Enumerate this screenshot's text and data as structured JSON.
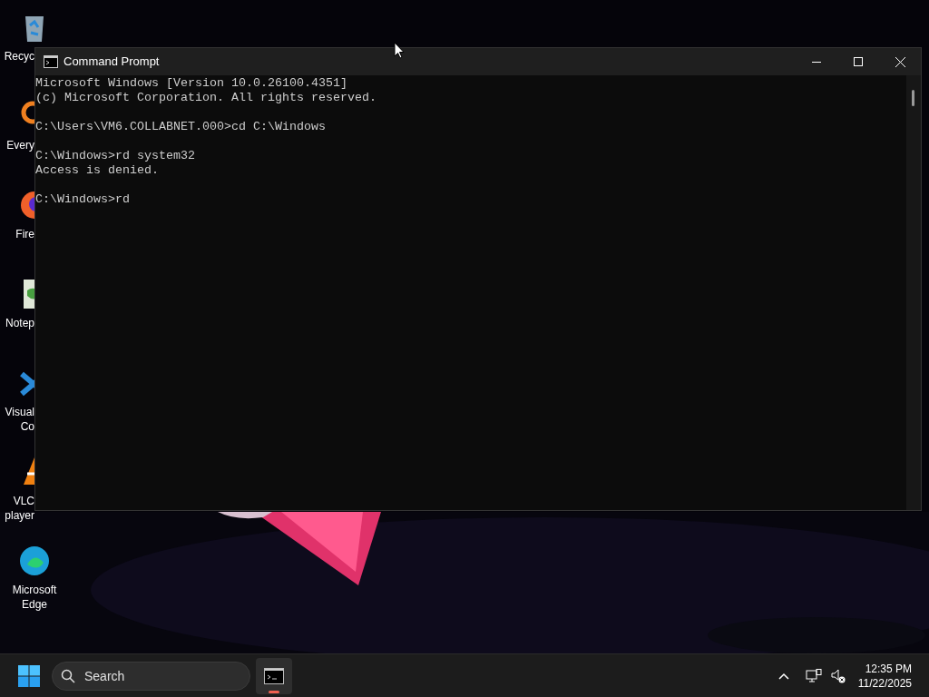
{
  "desktop_icons": [
    {
      "kind": "recycle",
      "lines": [
        "Recyc"
      ]
    },
    {
      "kind": "search",
      "lines": [
        "Every"
      ]
    },
    {
      "kind": "firefox",
      "lines": [
        "Fire"
      ]
    },
    {
      "kind": "notepad",
      "lines": [
        "Notep"
      ]
    },
    {
      "kind": "vscode",
      "lines": [
        "Visual",
        "Co"
      ]
    },
    {
      "kind": "vlc",
      "lines": [
        "VLC",
        "player"
      ]
    },
    {
      "kind": "edge",
      "lines": [
        "Microsoft",
        "Edge"
      ]
    }
  ],
  "window": {
    "title": "Command Prompt",
    "output_blocks": [
      [
        "Microsoft Windows [Version 10.0.26100.4351]",
        "(c) Microsoft Corporation. All rights reserved."
      ],
      [
        "C:\\Users\\VM6.COLLABNET.000>cd C:\\Windows"
      ],
      [
        "C:\\Windows>rd system32",
        "Access is denied."
      ],
      [
        "C:\\Windows>rd"
      ]
    ]
  },
  "taskbar": {
    "search": {
      "placeholder": "Search"
    },
    "apps": [
      {
        "kind": "terminal",
        "running": true
      }
    ],
    "clock": {
      "time": "12:35 PM",
      "date": "11/22/2025"
    }
  }
}
